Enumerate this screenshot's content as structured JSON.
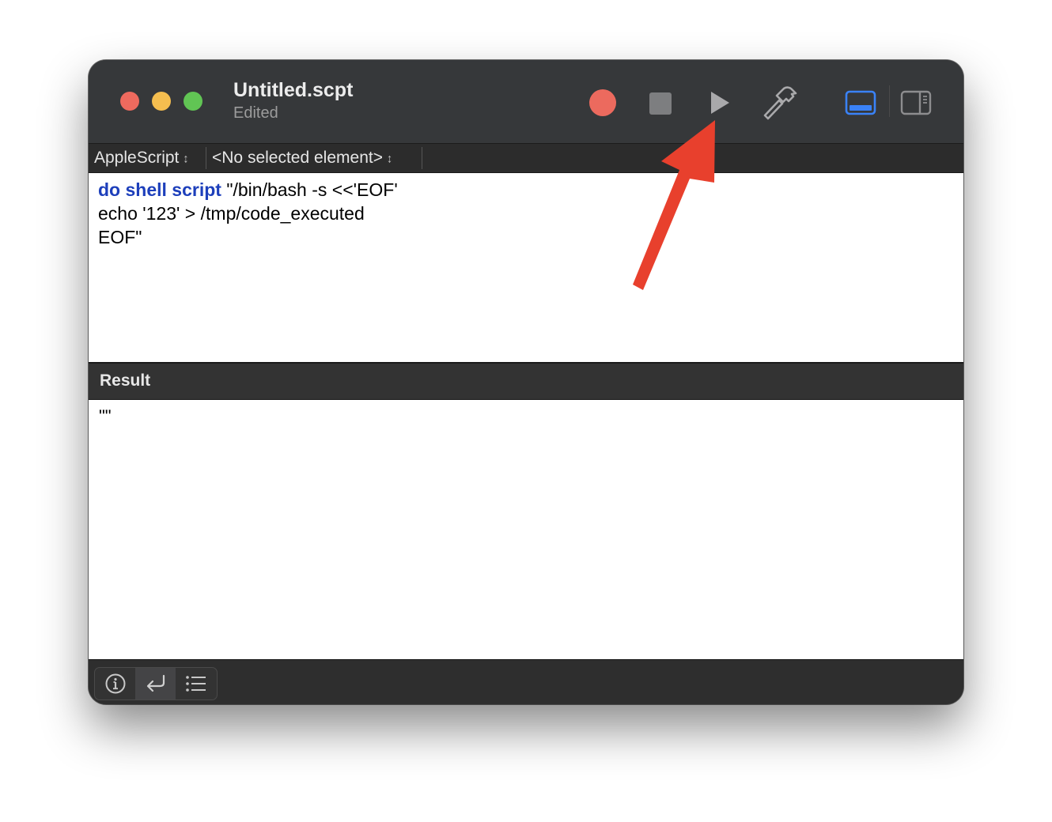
{
  "window": {
    "title": "Untitled.scpt",
    "subtitle": "Edited"
  },
  "toolbar": {
    "record_icon": "record-icon",
    "stop_icon": "stop-icon",
    "run_icon": "play-icon",
    "compile_icon": "hammer-icon",
    "view_bottom_icon": "bottom-panel-icon",
    "view_side_icon": "side-panel-icon"
  },
  "navbar": {
    "language": "AppleScript",
    "element": "<No selected element>"
  },
  "editor": {
    "line1_keyword": "do shell script",
    "line1_rest": " \"/bin/bash -s <<'EOF'",
    "line2": "echo '123' > /tmp/code_executed",
    "line3": "EOF\""
  },
  "result": {
    "header": "Result",
    "value": "\"\""
  },
  "bottom_bar": {
    "buttons": [
      "info-icon",
      "return-icon",
      "list-icon"
    ]
  },
  "colors": {
    "keyword": "#1d3fbb",
    "record": "#ec6a5e",
    "accent": "#3a82f7",
    "annotation_arrow": "#e8402d"
  }
}
